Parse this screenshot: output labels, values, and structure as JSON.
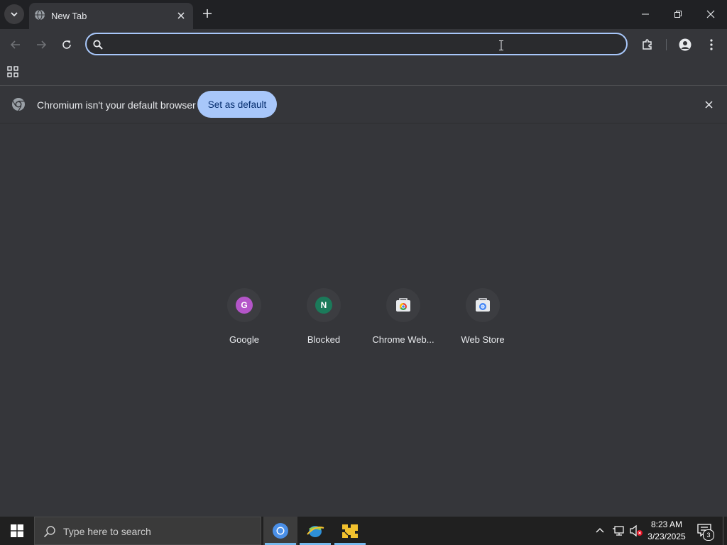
{
  "tab": {
    "title": "New Tab"
  },
  "omnibox": {
    "value": "",
    "placeholder": ""
  },
  "infobar": {
    "message": "Chromium isn't your default browser",
    "button_label": "Set as default"
  },
  "shortcuts": [
    {
      "label": "Google",
      "letter": "G",
      "color": "#b455c9"
    },
    {
      "label": "Blocked",
      "letter": "N",
      "color": "#1b7a5a"
    },
    {
      "label": "Chrome Web...",
      "icon": "chrome-web-store-icon"
    },
    {
      "label": "Web Store",
      "icon": "web-store-icon"
    }
  ],
  "taskbar": {
    "search_placeholder": "Type here to search",
    "time": "8:23 AM",
    "date": "3/23/2025",
    "notification_count": "3"
  },
  "colors": {
    "accent": "#a8c7fa",
    "background": "#35363a",
    "titlebar": "#202124"
  }
}
